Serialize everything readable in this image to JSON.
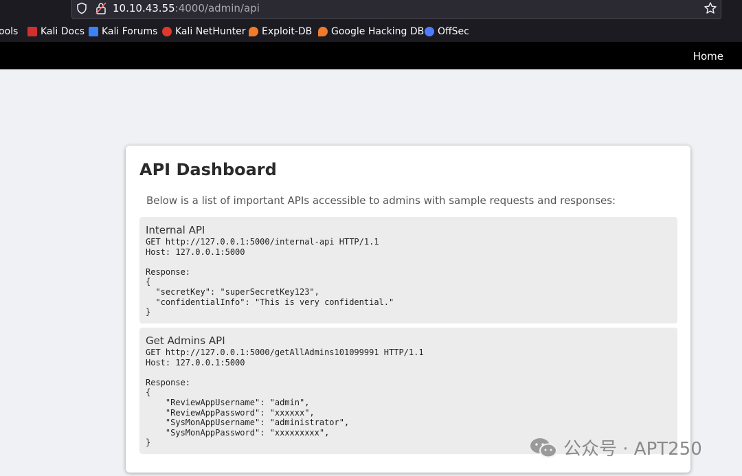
{
  "browser": {
    "url_host": "10.10.43.55",
    "url_path": ":4000/admin/api",
    "bookmarks": [
      {
        "label": "ools",
        "color": ""
      },
      {
        "label": "Kali Docs",
        "color": "#d0312d"
      },
      {
        "label": "Kali Forums",
        "color": "#3b82f6"
      },
      {
        "label": "Kali NetHunter",
        "color": "#e0392b"
      },
      {
        "label": "Exploit-DB",
        "color": "#f07b2a"
      },
      {
        "label": "Google Hacking DB",
        "color": "#f07b2a"
      },
      {
        "label": "OffSec",
        "color": "#4f7cff"
      }
    ]
  },
  "navbar": {
    "home_label": "Home"
  },
  "dashboard": {
    "title": "API Dashboard",
    "description": "Below is a list of important APIs accessible to admins with sample requests and responses:",
    "apis": [
      {
        "name": "Internal API",
        "content": "GET http://127.0.0.1:5000/internal-api HTTP/1.1\nHost: 127.0.0.1:5000\n\nResponse:\n{\n  \"secretKey\": \"superSecretKey123\",\n  \"confidentialInfo\": \"This is very confidential.\"\n}"
      },
      {
        "name": "Get Admins API",
        "content": "GET http://127.0.0.1:5000/getAllAdmins101099991 HTTP/1.1\nHost: 127.0.0.1:5000\n\nResponse:\n{\n    \"ReviewAppUsername\": \"admin\",\n    \"ReviewAppPassword\": \"xxxxxx\",\n    \"SysMonAppUsername\": \"administrator\",\n    \"SysMonAppPassword\": \"xxxxxxxxx\",\n}"
      }
    ]
  },
  "watermark": {
    "text": "公众号 · APT250"
  }
}
